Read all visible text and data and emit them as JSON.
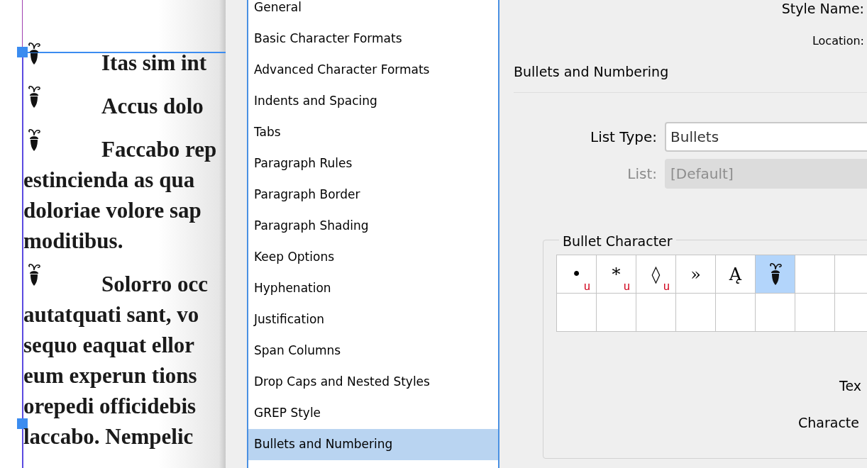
{
  "document": {
    "paragraphs": [
      {
        "bullet": true,
        "lines": [
          "Itas sim int"
        ]
      },
      {
        "bullet": true,
        "lines": [
          "Accus dolo"
        ]
      },
      {
        "bullet": true,
        "lines": [
          "Faccabo rep",
          "estincienda as qua",
          "doloriae volore sap",
          "moditibus."
        ]
      },
      {
        "bullet": true,
        "lines": [
          "Solorro occ",
          "autatquati sant, vo",
          "sequo eaquat ellor",
          "eum experun tions",
          "orepedi officidebis",
          "laccabo. Nempelic"
        ]
      }
    ]
  },
  "categories": [
    {
      "label": "General",
      "selected": false
    },
    {
      "label": "Basic Character Formats",
      "selected": false
    },
    {
      "label": "Advanced Character Formats",
      "selected": false
    },
    {
      "label": "Indents and Spacing",
      "selected": false
    },
    {
      "label": "Tabs",
      "selected": false
    },
    {
      "label": "Paragraph Rules",
      "selected": false
    },
    {
      "label": "Paragraph Border",
      "selected": false
    },
    {
      "label": "Paragraph Shading",
      "selected": false
    },
    {
      "label": "Keep Options",
      "selected": false
    },
    {
      "label": "Hyphenation",
      "selected": false
    },
    {
      "label": "Justification",
      "selected": false
    },
    {
      "label": "Span Columns",
      "selected": false
    },
    {
      "label": "Drop Caps and Nested Styles",
      "selected": false
    },
    {
      "label": "GREP Style",
      "selected": false
    },
    {
      "label": "Bullets and Numbering",
      "selected": true
    }
  ],
  "style_name_label": "Style Name:",
  "location_label": "Location:",
  "section_title": "Bullets and Numbering",
  "list_type": {
    "label": "List Type:",
    "value": "Bullets",
    "disabled": false
  },
  "list": {
    "label": "List:",
    "value": "[Default]",
    "disabled": true
  },
  "bullet_character": {
    "title": "Bullet Character",
    "cells": [
      {
        "kind": "glyph",
        "glyph": "•",
        "badge": "u",
        "selected": false
      },
      {
        "kind": "glyph",
        "glyph": "*",
        "badge": "u",
        "selected": false
      },
      {
        "kind": "glyph",
        "glyph": "◊",
        "badge": "u",
        "selected": false
      },
      {
        "kind": "glyph",
        "glyph": "»",
        "selected": false
      },
      {
        "kind": "glyph",
        "glyph": "Ą",
        "selected": false
      },
      {
        "kind": "acorn",
        "selected": true
      },
      {
        "kind": "empty",
        "selected": false
      },
      {
        "kind": "empty",
        "selected": false
      },
      {
        "kind": "empty",
        "selected": false
      },
      {
        "kind": "empty",
        "selected": false
      },
      {
        "kind": "empty",
        "selected": false
      },
      {
        "kind": "empty",
        "selected": false
      },
      {
        "kind": "empty",
        "selected": false
      },
      {
        "kind": "empty",
        "selected": false
      },
      {
        "kind": "empty",
        "selected": false
      },
      {
        "kind": "empty",
        "selected": false
      }
    ],
    "labels": [
      "Tex",
      "Characte"
    ]
  }
}
